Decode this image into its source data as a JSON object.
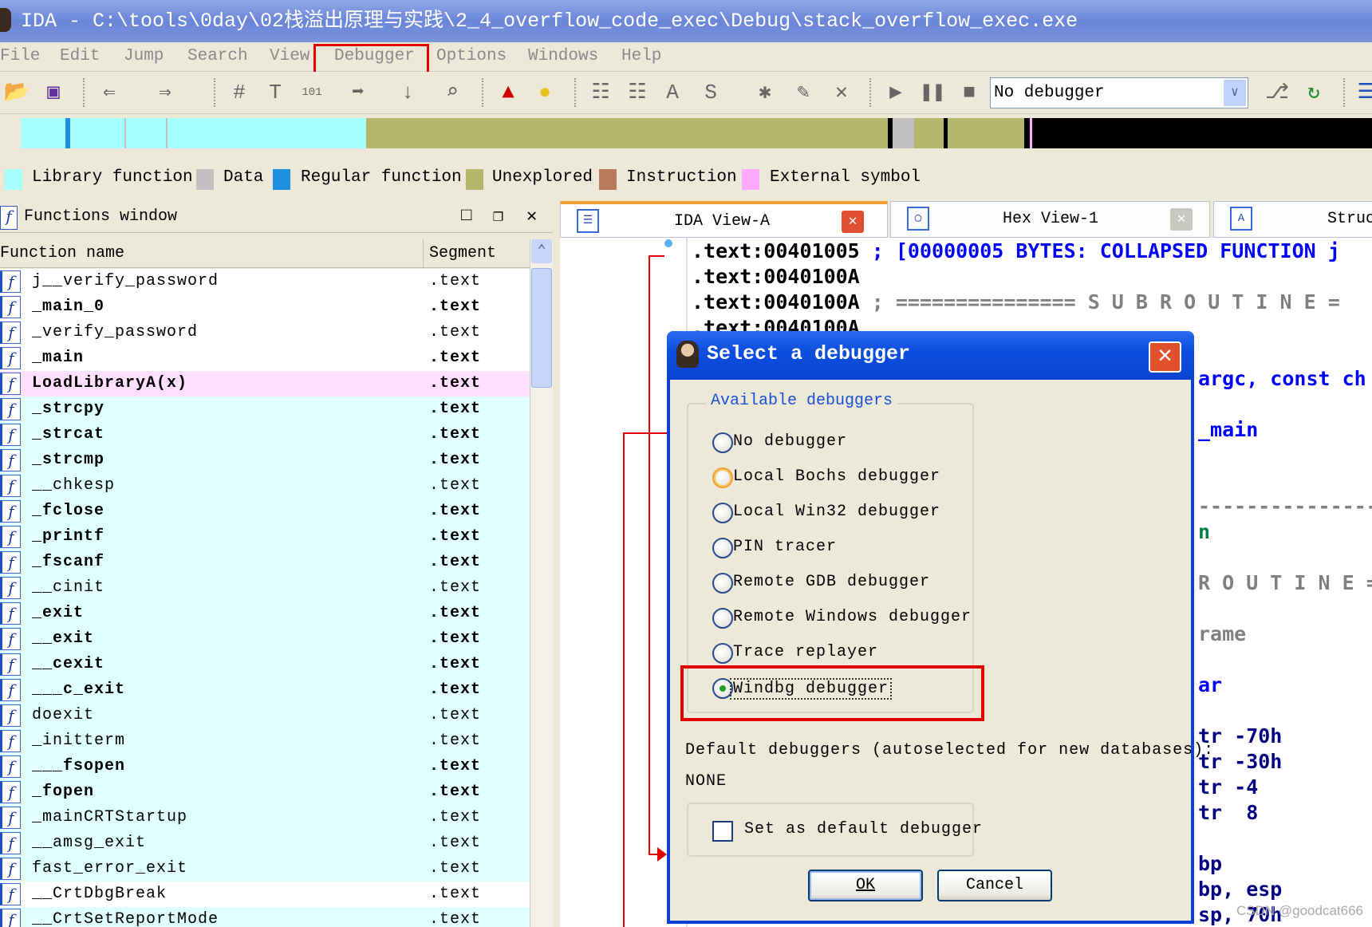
{
  "window": {
    "title": "IDA - C:\\tools\\0day\\02栈溢出原理与实践\\2_4_overflow_code_exec\\Debug\\stack_overflow_exec.exe"
  },
  "menu": [
    "File",
    "Edit",
    "Jump",
    "Search",
    "View",
    "Debugger",
    "Options",
    "Windows",
    "Help"
  ],
  "toolbar": {
    "debugger_select": "No debugger"
  },
  "legend": [
    {
      "label": "Library function",
      "color": "#a8ffff"
    },
    {
      "label": "Data",
      "color": "#c0c0c0"
    },
    {
      "label": "Regular function",
      "color": "#1e90e0"
    },
    {
      "label": "Unexplored",
      "color": "#b5b56b"
    },
    {
      "label": "Instruction",
      "color": "#b87c5c"
    },
    {
      "label": "External symbol",
      "color": "#ffaaff"
    }
  ],
  "functions_window": {
    "title": "Functions window",
    "columns": [
      "Function name",
      "Segment"
    ],
    "rows": [
      {
        "name": "j__verify_password",
        "segment": ".text",
        "bold": false,
        "kind": "regular"
      },
      {
        "name": "_main_0",
        "segment": ".text",
        "bold": true,
        "kind": "regular"
      },
      {
        "name": "_verify_password",
        "segment": ".text",
        "bold": false,
        "kind": "regular"
      },
      {
        "name": "_main",
        "segment": ".text",
        "bold": true,
        "kind": "regular"
      },
      {
        "name": "LoadLibraryA(x)",
        "segment": ".text",
        "bold": true,
        "kind": "external"
      },
      {
        "name": "_strcpy",
        "segment": ".text",
        "bold": true,
        "kind": "library"
      },
      {
        "name": "_strcat",
        "segment": ".text",
        "bold": true,
        "kind": "library"
      },
      {
        "name": "_strcmp",
        "segment": ".text",
        "bold": true,
        "kind": "library"
      },
      {
        "name": "__chkesp",
        "segment": ".text",
        "bold": false,
        "kind": "library"
      },
      {
        "name": "_fclose",
        "segment": ".text",
        "bold": true,
        "kind": "library"
      },
      {
        "name": "_printf",
        "segment": ".text",
        "bold": true,
        "kind": "library"
      },
      {
        "name": "_fscanf",
        "segment": ".text",
        "bold": true,
        "kind": "library"
      },
      {
        "name": "__cinit",
        "segment": ".text",
        "bold": false,
        "kind": "library"
      },
      {
        "name": "_exit",
        "segment": ".text",
        "bold": true,
        "kind": "library"
      },
      {
        "name": "__exit",
        "segment": ".text",
        "bold": true,
        "kind": "library"
      },
      {
        "name": "__cexit",
        "segment": ".text",
        "bold": true,
        "kind": "library"
      },
      {
        "name": "___c_exit",
        "segment": ".text",
        "bold": true,
        "kind": "library"
      },
      {
        "name": "doexit",
        "segment": ".text",
        "bold": false,
        "kind": "library"
      },
      {
        "name": "_initterm",
        "segment": ".text",
        "bold": false,
        "kind": "library"
      },
      {
        "name": "___fsopen",
        "segment": ".text",
        "bold": true,
        "kind": "library"
      },
      {
        "name": "_fopen",
        "segment": ".text",
        "bold": true,
        "kind": "library"
      },
      {
        "name": "_mainCRTStartup",
        "segment": ".text",
        "bold": false,
        "kind": "library"
      },
      {
        "name": "__amsg_exit",
        "segment": ".text",
        "bold": false,
        "kind": "library"
      },
      {
        "name": "fast_error_exit",
        "segment": ".text",
        "bold": false,
        "kind": "library"
      },
      {
        "name": "__CrtDbgBreak",
        "segment": ".text",
        "bold": false,
        "kind": "regular"
      },
      {
        "name": "__CrtSetReportMode",
        "segment": ".text",
        "bold": false,
        "kind": "library"
      }
    ]
  },
  "tabs": [
    {
      "label": "IDA View-A",
      "active": true
    },
    {
      "label": "Hex View-1",
      "active": false
    },
    {
      "label": "Struc",
      "active": false
    }
  ],
  "code": {
    "lines": [
      {
        "addr": ".text:00401005",
        "rest": " ; [00000005 BYTES: COLLAPSED FUNCTION j",
        "color": "#0000ff"
      },
      {
        "addr": ".text:0040100A",
        "rest": "",
        "color": "#000080"
      },
      {
        "addr": ".text:0040100A",
        "rest": " ; =============== S U B R O U T I N E =",
        "color": "#808080"
      },
      {
        "addr": ".text:0040100A",
        "rest": "",
        "color": "#000080"
      }
    ],
    "fragments": [
      {
        "text": "argc, const ch",
        "color": "#0000ff"
      },
      {
        "text": "_main",
        "color": "#0000ff"
      },
      {
        "text": "-------------------",
        "color": "#808080"
      },
      {
        "text": "n",
        "color": "#008040"
      },
      {
        "text": "R O U T I N E =",
        "color": "#808080"
      },
      {
        "text": "rame",
        "color": "#808080"
      },
      {
        "text": "ar",
        "color": "#0000ff"
      },
      {
        "text": "tr -70h",
        "color": "#000080"
      },
      {
        "text": "tr -30h",
        "color": "#000080"
      },
      {
        "text": "tr -4",
        "color": "#000080"
      },
      {
        "text": "tr  8",
        "color": "#000080"
      },
      {
        "text": "bp",
        "color": "#000080"
      },
      {
        "text": "bp, esp",
        "color": "#000080"
      },
      {
        "text": "sp, 70h",
        "color": "#000080"
      }
    ]
  },
  "dialog": {
    "title": "Select a debugger",
    "group_label": "Available debuggers",
    "options": [
      {
        "label": "No debugger",
        "selected": false
      },
      {
        "label": "Local Bochs debugger",
        "selected": false
      },
      {
        "label": "Local Win32 debugger",
        "selected": false
      },
      {
        "label": "PIN tracer",
        "selected": false
      },
      {
        "label": "Remote GDB debugger",
        "selected": false
      },
      {
        "label": "Remote Windows debugger",
        "selected": false
      },
      {
        "label": "Trace replayer",
        "selected": false
      },
      {
        "label": "Windbg debugger",
        "selected": true
      }
    ],
    "default_label": "Default debuggers (autoselected for new databases):",
    "default_value": "NONE",
    "checkbox_label": "Set as default debugger",
    "checkbox_checked": false,
    "ok": "OK",
    "cancel": "Cancel"
  },
  "watermark": "CSDN @goodcat666"
}
